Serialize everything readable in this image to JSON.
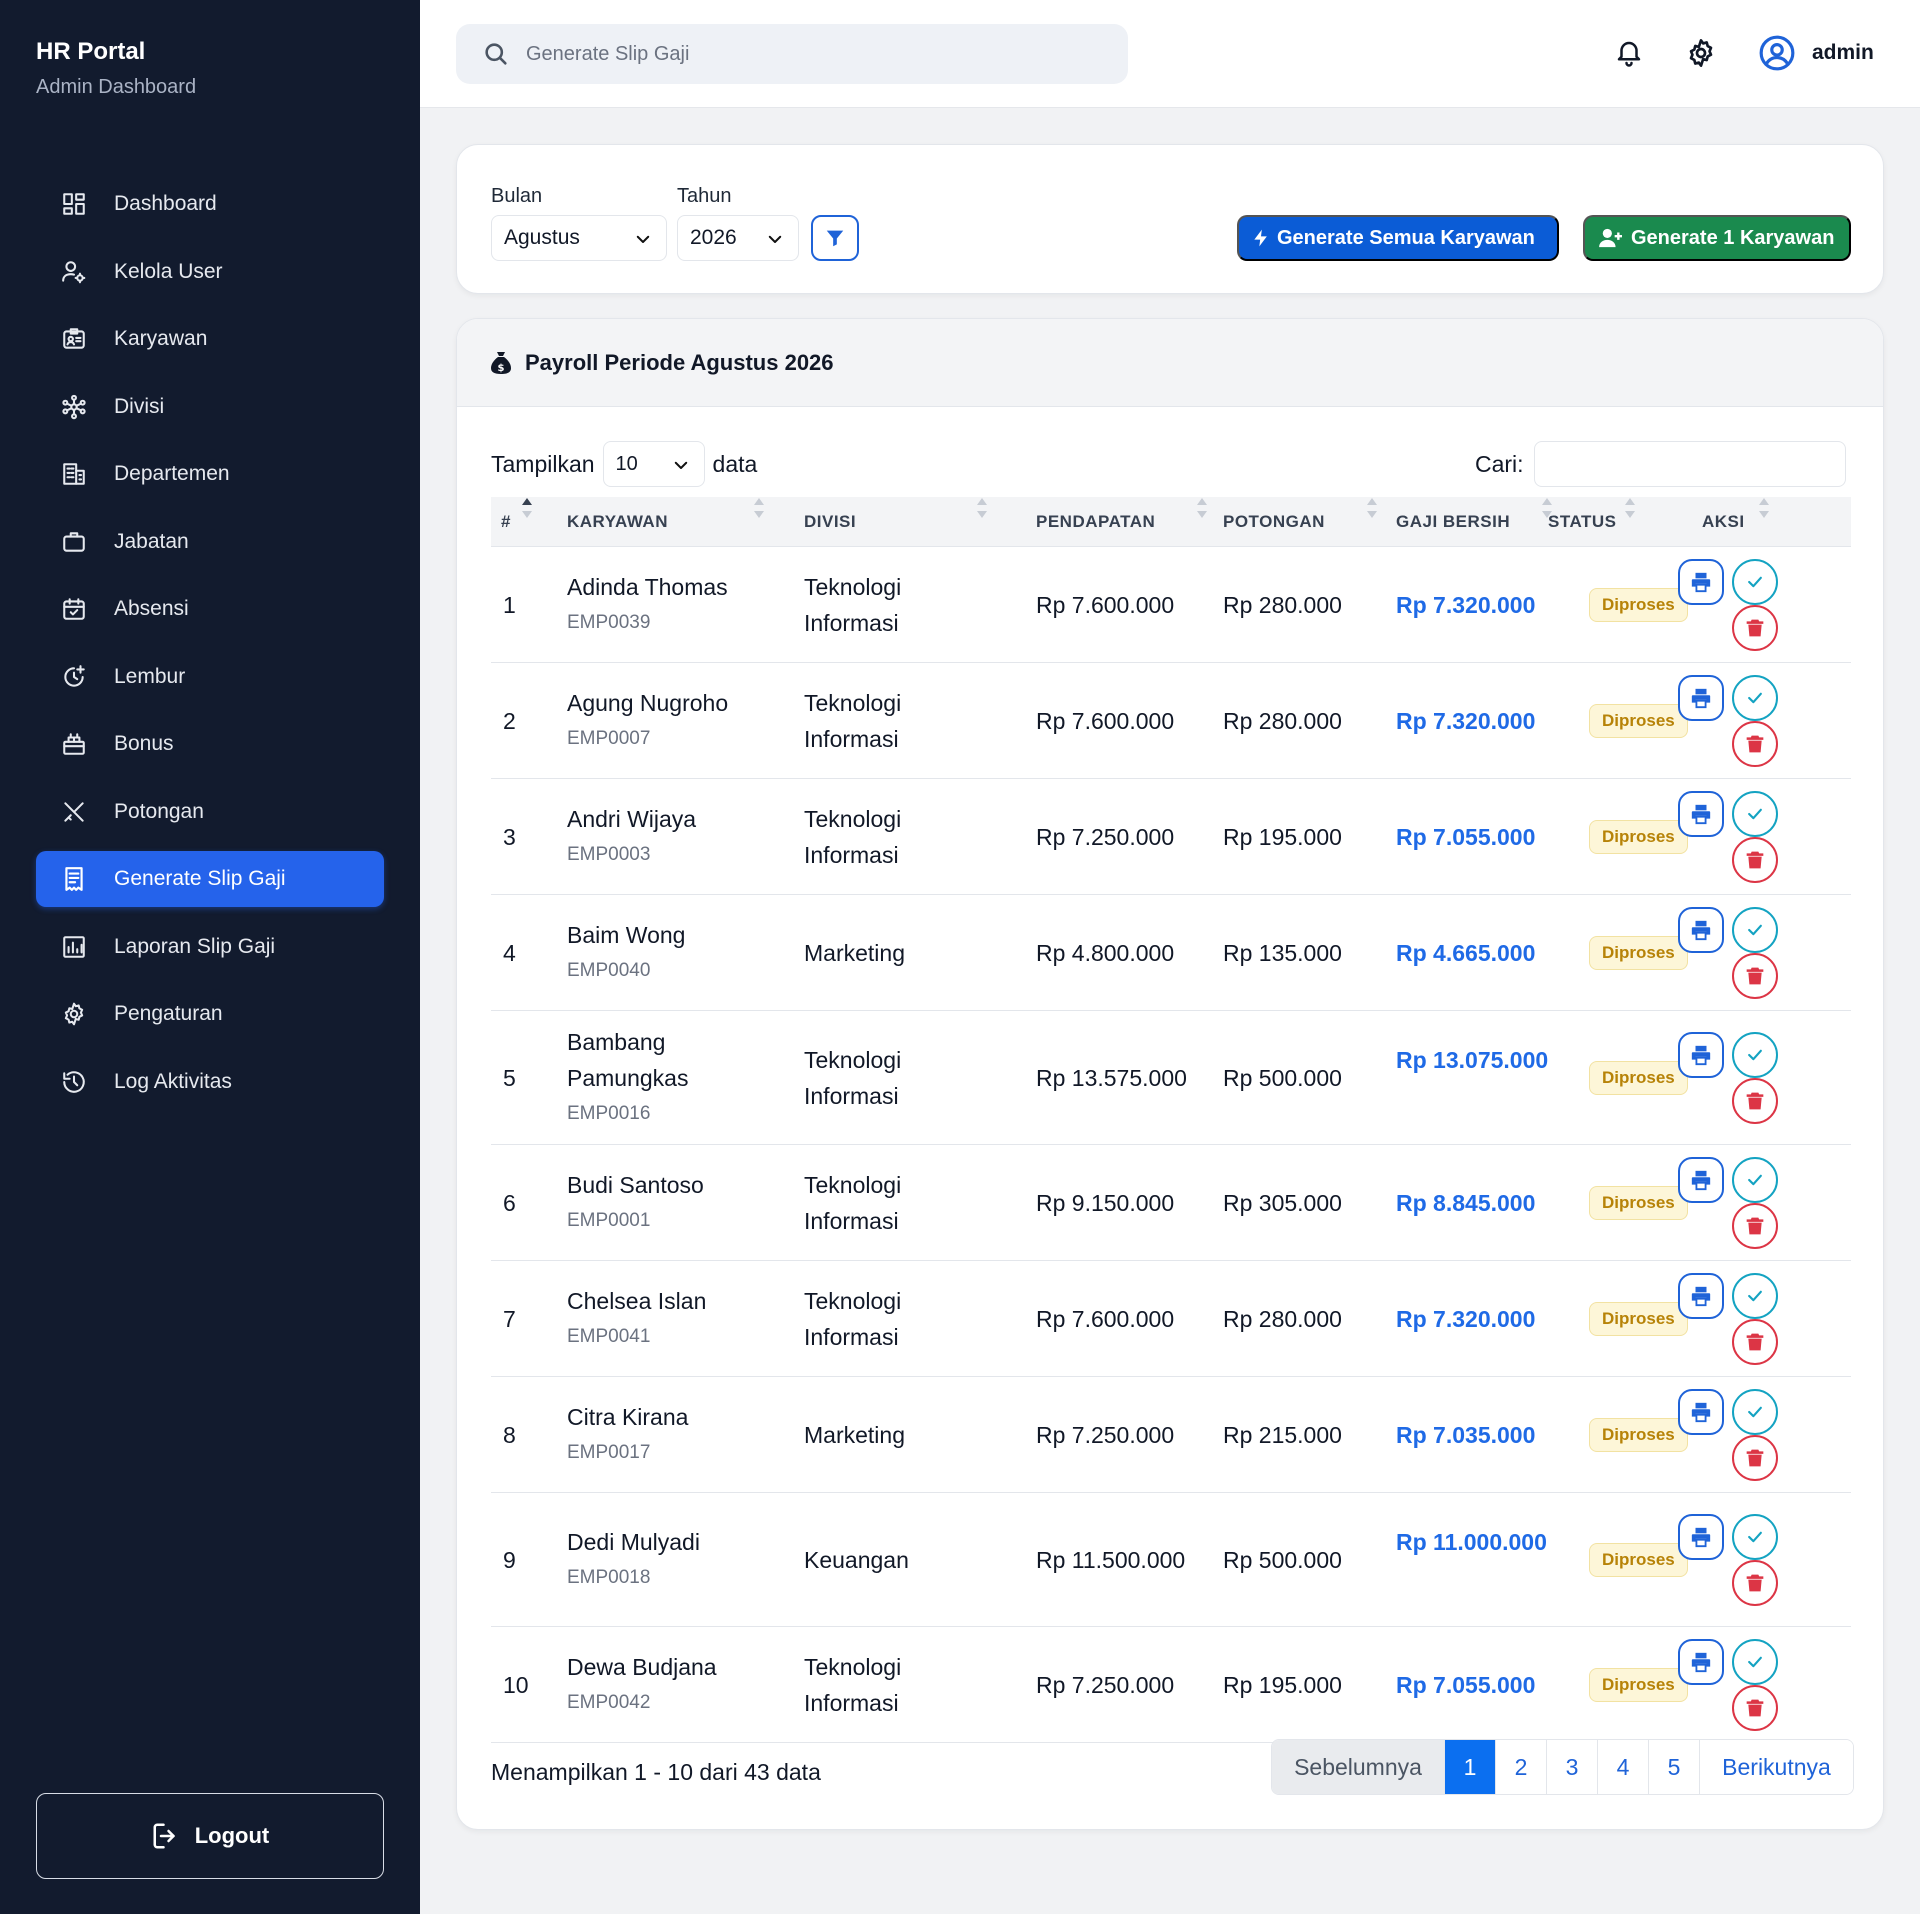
{
  "brand": {
    "title": "HR Portal",
    "subtitle": "Admin Dashboard"
  },
  "sidebar": {
    "items": [
      {
        "label": "Dashboard",
        "icon": "dashboard-grid-icon"
      },
      {
        "label": "Kelola User",
        "icon": "user-cog-icon"
      },
      {
        "label": "Karyawan",
        "icon": "id-card-icon"
      },
      {
        "label": "Divisi",
        "icon": "network-icon"
      },
      {
        "label": "Departemen",
        "icon": "building-icon"
      },
      {
        "label": "Jabatan",
        "icon": "briefcase-icon"
      },
      {
        "label": "Absensi",
        "icon": "calendar-check-icon"
      },
      {
        "label": "Lembur",
        "icon": "clock-plus-icon"
      },
      {
        "label": "Bonus",
        "icon": "gift-icon"
      },
      {
        "label": "Potongan",
        "icon": "scissors-icon"
      },
      {
        "label": "Generate Slip Gaji",
        "icon": "receipt-icon",
        "active": true
      },
      {
        "label": "Laporan Slip Gaji",
        "icon": "bar-chart-icon"
      },
      {
        "label": "Pengaturan",
        "icon": "gear-icon"
      },
      {
        "label": "Log Aktivitas",
        "icon": "history-icon"
      }
    ],
    "logout_label": "Logout"
  },
  "topbar": {
    "search_placeholder": "Generate Slip Gaji",
    "username": "admin"
  },
  "filter": {
    "bulan_label": "Bulan",
    "bulan_value": "Agustus",
    "tahun_label": "Tahun",
    "tahun_value": "2026",
    "generate_all_label": "Generate Semua Karyawan",
    "generate_one_label": "Generate 1 Karyawan"
  },
  "table": {
    "title": "Payroll Periode Agustus 2026",
    "show_prefix": "Tampilkan",
    "show_value": "10",
    "show_suffix": "data",
    "search_label": "Cari:",
    "columns": [
      "#",
      "KARYAWAN",
      "DIVISI",
      "PENDAPATAN",
      "POTONGAN",
      "GAJI BERSIH",
      "STATUS",
      "AKSI"
    ],
    "rows": [
      {
        "no": "1",
        "name": "Adinda Thomas",
        "id": "EMP0039",
        "divisi": "Teknologi Informasi",
        "pendapatan": "Rp 7.600.000",
        "potongan": "Rp 280.000",
        "gaji": "Rp 7.320.000",
        "status": "Diproses"
      },
      {
        "no": "2",
        "name": "Agung Nugroho",
        "id": "EMP0007",
        "divisi": "Teknologi Informasi",
        "pendapatan": "Rp 7.600.000",
        "potongan": "Rp 280.000",
        "gaji": "Rp 7.320.000",
        "status": "Diproses"
      },
      {
        "no": "3",
        "name": "Andri Wijaya",
        "id": "EMP0003",
        "divisi": "Teknologi Informasi",
        "pendapatan": "Rp 7.250.000",
        "potongan": "Rp 195.000",
        "gaji": "Rp 7.055.000",
        "status": "Diproses"
      },
      {
        "no": "4",
        "name": "Baim Wong",
        "id": "EMP0040",
        "divisi": "Marketing",
        "pendapatan": "Rp 4.800.000",
        "potongan": "Rp 135.000",
        "gaji": "Rp 4.665.000",
        "status": "Diproses"
      },
      {
        "no": "5",
        "name": "Bambang Pamungkas",
        "id": "EMP0016",
        "divisi": "Teknologi Informasi",
        "pendapatan": "Rp 13.575.000",
        "potongan": "Rp 500.000",
        "gaji": "Rp 13.075.000",
        "status": "Diproses"
      },
      {
        "no": "6",
        "name": "Budi Santoso",
        "id": "EMP0001",
        "divisi": "Teknologi Informasi",
        "pendapatan": "Rp 9.150.000",
        "potongan": "Rp 305.000",
        "gaji": "Rp 8.845.000",
        "status": "Diproses"
      },
      {
        "no": "7",
        "name": "Chelsea Islan",
        "id": "EMP0041",
        "divisi": "Teknologi Informasi",
        "pendapatan": "Rp 7.600.000",
        "potongan": "Rp 280.000",
        "gaji": "Rp 7.320.000",
        "status": "Diproses"
      },
      {
        "no": "8",
        "name": "Citra Kirana",
        "id": "EMP0017",
        "divisi": "Marketing",
        "pendapatan": "Rp 7.250.000",
        "potongan": "Rp 215.000",
        "gaji": "Rp 7.035.000",
        "status": "Diproses"
      },
      {
        "no": "9",
        "name": "Dedi Mulyadi",
        "id": "EMP0018",
        "divisi": "Keuangan",
        "pendapatan": "Rp 11.500.000",
        "potongan": "Rp 500.000",
        "gaji": "Rp 11.000.000",
        "status": "Diproses"
      },
      {
        "no": "10",
        "name": "Dewa Budjana",
        "id": "EMP0042",
        "divisi": "Teknologi Informasi",
        "pendapatan": "Rp 7.250.000",
        "potongan": "Rp 195.000",
        "gaji": "Rp 7.055.000",
        "status": "Diproses"
      }
    ],
    "footer_info": "Menampilkan 1 - 10 dari 43 data",
    "pagination": {
      "prev": "Sebelumnya",
      "pages": [
        "1",
        "2",
        "3",
        "4",
        "5"
      ],
      "active": "1",
      "next": "Berikutnya"
    }
  },
  "colors": {
    "sidebar_bg": "#121b2e",
    "accent": "#2563eb",
    "green": "#1a8a4e",
    "net_salary": "#1f6ae6",
    "badge_text": "#b78308"
  }
}
